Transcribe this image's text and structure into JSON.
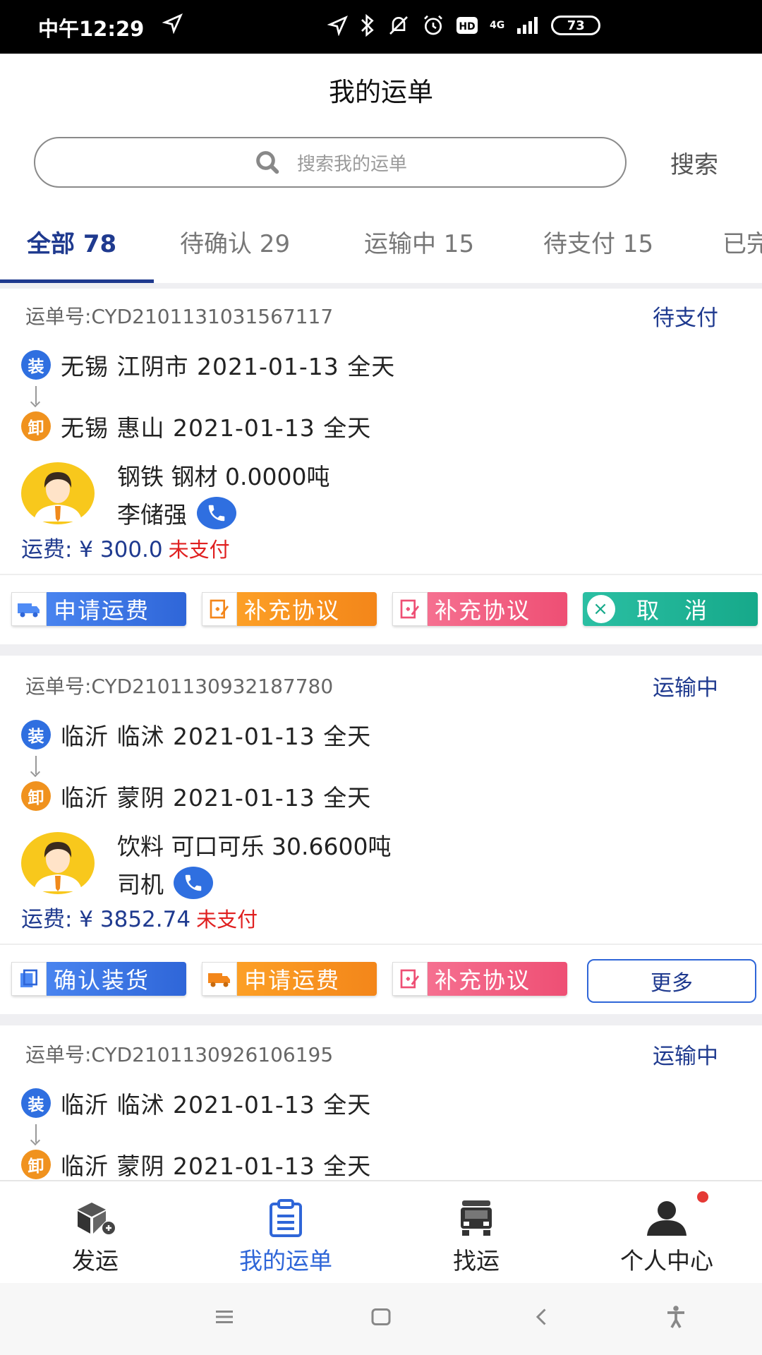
{
  "status_bar": {
    "time": "中午12:29",
    "battery": "73",
    "network": "4G"
  },
  "header": {
    "title": "我的运单"
  },
  "search": {
    "placeholder": "搜索我的运单",
    "button": "搜索"
  },
  "tabs": [
    {
      "label": "全部 78",
      "active": true
    },
    {
      "label": "待确认 29",
      "active": false
    },
    {
      "label": "运输中 15",
      "active": false
    },
    {
      "label": "待支付 15",
      "active": false
    },
    {
      "label": "已完",
      "active": false
    }
  ],
  "orders": [
    {
      "order_no": "运单号:CYD2101131031567117",
      "status": "待支付",
      "load_badge": "装",
      "load": "无锡 江阴市  2021-01-13  全天",
      "unload_badge": "卸",
      "unload": "无锡 惠山  2021-01-13  全天",
      "cargo": "钢铁  钢材 0.0000吨",
      "driver": "李储强",
      "fee": "运费: ¥ 300.0",
      "payment_status": "未支付",
      "actions": [
        "申请运费",
        "补充协议",
        "补充协议",
        "取　消"
      ]
    },
    {
      "order_no": "运单号:CYD2101130932187780",
      "status": "运输中",
      "load_badge": "装",
      "load": "临沂 临沭  2021-01-13  全天",
      "unload_badge": "卸",
      "unload": "临沂 蒙阴  2021-01-13  全天",
      "cargo": "饮料  可口可乐 30.6600吨",
      "driver": "司机",
      "fee": "运费: ¥ 3852.74",
      "payment_status": "未支付",
      "actions": [
        "确认装货",
        "申请运费",
        "补充协议",
        "更多"
      ]
    },
    {
      "order_no": "运单号:CYD2101130926106195",
      "status": "运输中",
      "load_badge": "装",
      "load": "临沂 临沭  2021-01-13  全天",
      "unload_badge": "卸",
      "unload": "临沂 蒙阴  2021-01-13  全天"
    }
  ],
  "bottom_nav": [
    {
      "label": "发运",
      "icon": "package-send-icon",
      "active": false
    },
    {
      "label": "我的运单",
      "icon": "clipboard-icon",
      "active": true
    },
    {
      "label": "找运",
      "icon": "truck-icon",
      "active": false
    },
    {
      "label": "个人中心",
      "icon": "user-icon",
      "active": false
    }
  ],
  "colors": {
    "primary": "#1f3a8f",
    "accent_blue": "#2f66d8",
    "orange": "#f3861a",
    "pink": "#ee4f74",
    "teal": "#16a98a",
    "unpaid_red": "#e02020"
  }
}
